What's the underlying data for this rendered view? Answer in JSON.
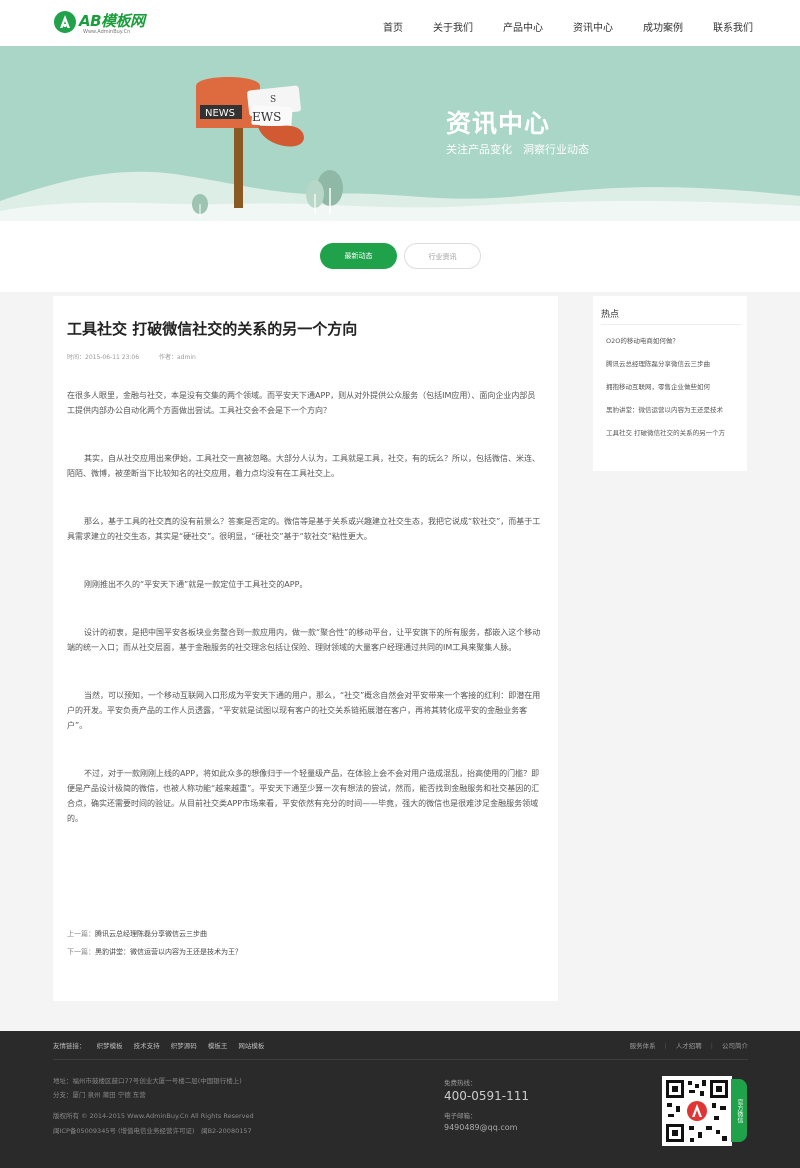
{
  "header": {
    "logo_text": "AB模板网",
    "logo_sub": "Www.AdminBuy.Cn",
    "nav": [
      "首页",
      "关于我们",
      "产品中心",
      "资讯中心",
      "成功案例",
      "联系我们"
    ]
  },
  "banner": {
    "title": "资讯中心",
    "subtitle": "关注产品变化　洞察行业动态",
    "sign_text_1": "NEWS",
    "sign_text_2": "EWS",
    "sign_text_3": "S"
  },
  "tabs": {
    "active": "最新动态",
    "inactive": "行业资讯"
  },
  "article": {
    "title": "工具社交 打破微信社交的关系的另一个方向",
    "date": "时间：2015-06-11 23:06",
    "author": "作者：admin",
    "paragraphs": [
      "在很多人眼里，金融与社交，本是没有交集的两个领域。而平安天下通APP，则从对外提供公众服务（包括IM应用）、面向企业内部员工提供内部办公自动化两个方面做出尝试。工具社交会不会是下一个方向？",
      "其实，自从社交应用出来伊始，工具社交一直被忽略。大部分人认为，工具就是工具，社交，有的玩么？所以，包括微信、米连、陌陌、微博，被垄断当下比较知名的社交应用，着力点均没有在工具社交上。",
      "那么，基于工具的社交真的没有前景么？答案是否定的。微信等是基于关系或兴趣建立社交生态，我把它说成“软社交”，而基于工具需求建立的社交生态，其实是“硬社交”。很明显，“硬社交”基于“软社交”粘性更大。",
      "刚刚推出不久的“平安天下通”就是一款定位于工具社交的APP。",
      "设计的初衷，是把中国平安各板块业务整合到一款应用内，做一款“聚合性”的移动平台，让平安旗下的所有服务，都嵌入这个移动端的统一入口；而从社交层面，基于金融服务的社交理念包括让保险、理财领域的大量客户经理通过共同的IM工具来聚集人脉。",
      "当然，可以预知，一个移动互联网入口形成为平安天下通的用户，那么，“社交”概念自然会对平安带来一个客接的红利：即潜在用户的开发。平安负责产品的工作人员透露，“平安就是试图以现有客户的社交关系链拓展潜在客户，再将其转化成平安的金融业务客户”。",
      "不过，对于一款刚刚上线的APP，将如此众多的想像归于一个轻量级产品，在体验上会不会对用户造成混乱，抬高使用的门槛？即便是产品设计极简的微信，也被人称功能“越来越重”。平安天下通至少算一次有想法的尝试，然而，能否找到金融服务和社交基因的汇合点，确实还需要时间的验证。从目前社交类APP市场来看，平安依然有充分的时间——毕竟，强大的微信也是很难涉足金融服务领域的。"
    ],
    "prev_label": "上一篇：",
    "prev_title": "腾讯云总经理陈磊分享微信云三步曲",
    "next_label": "下一篇：",
    "next_title": "黑豹讲堂：微信运营以内容为王还是技术为王？"
  },
  "sidebar": {
    "title": "热点",
    "items": [
      "O2O的移动电商如何做？",
      "腾讯云总经理陈磊分享微信云三步曲",
      "拥抱移动互联网，零售企业做些如何",
      "黑豹讲堂：微信运营以内容为王还是技术",
      "工具社交 打破微信社交的关系的另一个方"
    ]
  },
  "footer": {
    "links_label": "友情链接：",
    "links": [
      "织梦模板",
      "技术支持",
      "织梦源码",
      "模板王",
      "网站模板"
    ],
    "right_links": [
      "服务体系",
      "人才招聘",
      "公司简介"
    ],
    "address": "地址：福州市鼓楼区鼓口77号创业大厦一号楼二层(中国银行楼上)",
    "branches": "分支：厦门 泉州 莆田 宁德 东营",
    "copyright": "版权所有 © 2014-2015 Www.AdminBuy.Cn All Rights Reserved",
    "icp": "闽ICP备05009345号 (增值电信业务经营许可证)　闽B2-20080157",
    "phone_label": "免费热线：",
    "phone": "400-0591-111",
    "email_label": "电子邮箱：",
    "email": "9490489@qq.com",
    "qr_tab": "官方微信"
  }
}
